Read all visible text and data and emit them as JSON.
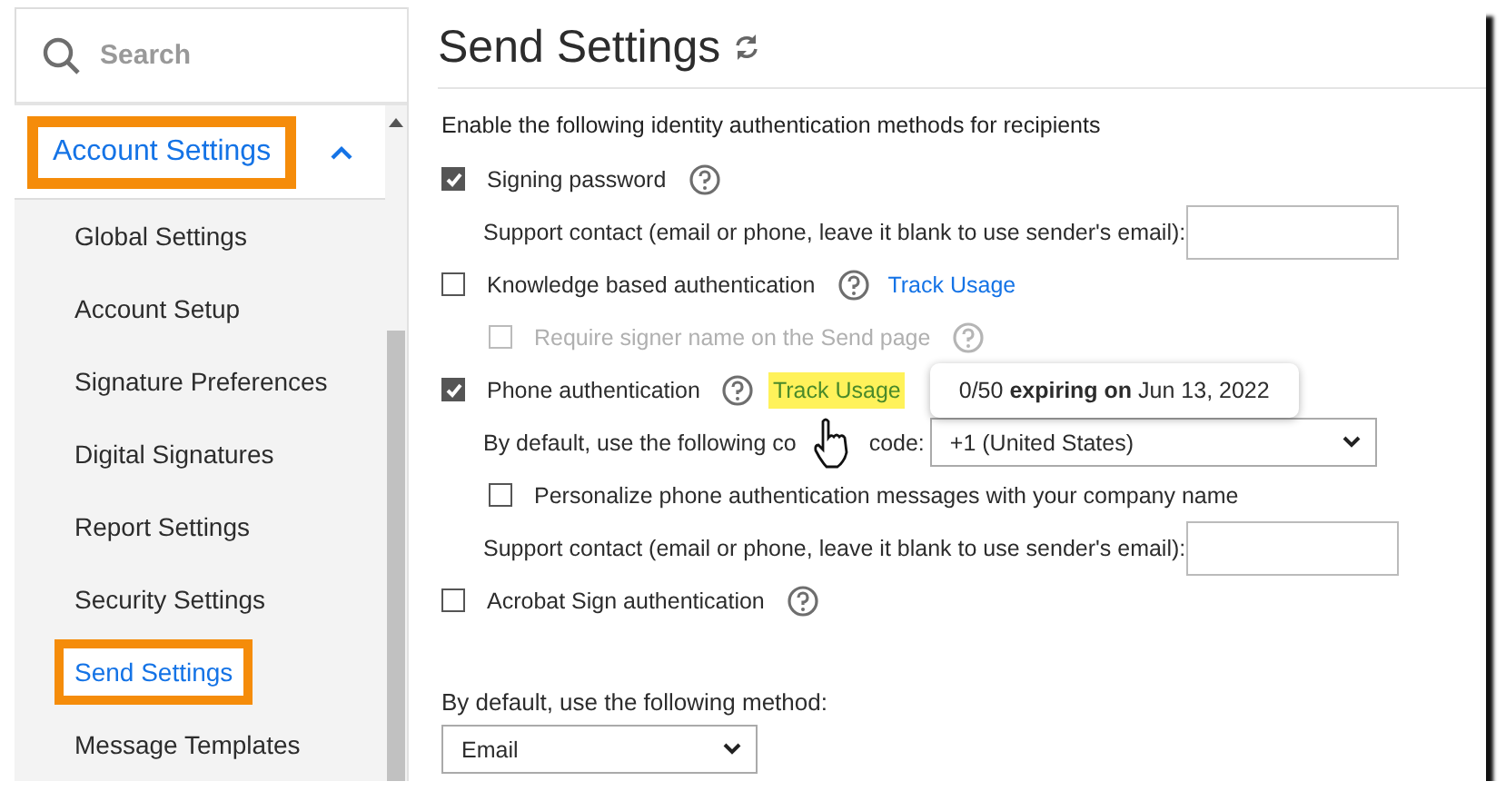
{
  "sidebar": {
    "search": {
      "placeholder": "Search"
    },
    "section": {
      "label": "Account Settings",
      "expanded": true,
      "highlighted": true
    },
    "items": [
      {
        "label": "Global Settings",
        "selected": false,
        "highlighted": false
      },
      {
        "label": "Account Setup",
        "selected": false,
        "highlighted": false
      },
      {
        "label": "Signature Preferences",
        "selected": false,
        "highlighted": false
      },
      {
        "label": "Digital Signatures",
        "selected": false,
        "highlighted": false
      },
      {
        "label": "Report Settings",
        "selected": false,
        "highlighted": false
      },
      {
        "label": "Security Settings",
        "selected": false,
        "highlighted": false
      },
      {
        "label": "Send Settings",
        "selected": true,
        "highlighted": true
      },
      {
        "label": "Message Templates",
        "selected": false,
        "highlighted": false
      }
    ]
  },
  "page": {
    "title": "Send Settings",
    "heading": "Enable the following identity authentication methods for recipients",
    "options": [
      {
        "kind": "checkbox",
        "label": "Signing password",
        "checked": true,
        "disabled": false,
        "help": true,
        "indent": false
      },
      {
        "kind": "contact",
        "label": "Support contact (email or phone, leave it blank to use sender's email):"
      },
      {
        "kind": "checkbox",
        "label": "Knowledge based authentication",
        "checked": false,
        "disabled": false,
        "help": true,
        "indent": false,
        "link": {
          "label": "Track Usage",
          "highlighted": false
        }
      },
      {
        "kind": "checkbox",
        "label": "Require signer name on the Send page",
        "checked": false,
        "disabled": true,
        "help": true,
        "indent": true
      },
      {
        "kind": "checkbox",
        "label": "Phone authentication",
        "checked": true,
        "disabled": false,
        "help": true,
        "indent": false,
        "link": {
          "label": "Track Usage",
          "highlighted": true
        },
        "tooltip": "0/50 **expiring on** Jun 13, 2022"
      },
      {
        "kind": "select",
        "label": "By default, use the following co",
        "label_end": "code:",
        "value": "+1 (United States)"
      },
      {
        "kind": "checkbox",
        "label": "Personalize phone authentication messages with your company name",
        "checked": false,
        "disabled": false,
        "help": false,
        "indent": true
      },
      {
        "kind": "contact",
        "label": "Support contact (email or phone, leave it blank to use sender's email):"
      },
      {
        "kind": "checkbox",
        "label": "Acrobat Sign authentication",
        "checked": false,
        "disabled": false,
        "help": true,
        "indent": false
      }
    ],
    "method": {
      "label": "By default, use the following method:",
      "value": "Email"
    }
  }
}
